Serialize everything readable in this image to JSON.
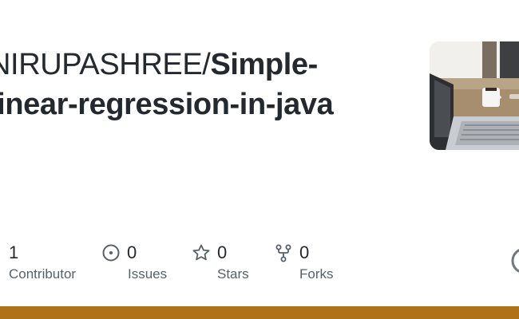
{
  "repo": {
    "owner": "NIRUPASHREE/",
    "name": "Simple-linear-regression-in-java"
  },
  "stats": {
    "contributors": {
      "count": "1",
      "label": "Contributor"
    },
    "issues": {
      "count": "0",
      "label": "Issues",
      "icon": "issue-opened-icon"
    },
    "stars": {
      "count": "0",
      "label": "Stars",
      "icon": "star-icon"
    },
    "forks": {
      "count": "0",
      "label": "Forks",
      "icon": "repo-forked-icon"
    }
  },
  "colors": {
    "language_bar": "#b07219",
    "text": "#24292f",
    "muted": "#57606a"
  }
}
